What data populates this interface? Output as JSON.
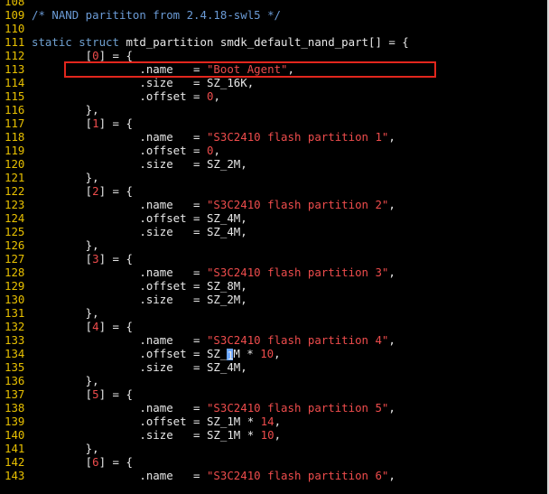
{
  "editor": {
    "lines": [
      {
        "ln": "108",
        "code": [
          {
            "t": "",
            "c": "plain"
          }
        ]
      },
      {
        "ln": "109",
        "code": [
          {
            "t": "/* NAND parititon from 2.4.18-swl5 */",
            "c": "cm"
          }
        ]
      },
      {
        "ln": "110",
        "code": [
          {
            "t": "",
            "c": "plain"
          }
        ]
      },
      {
        "ln": "111",
        "code": [
          {
            "t": "static struct",
            "c": "kw"
          },
          {
            "t": " mtd_partition smdk_default_nand_part[] = {",
            "c": "plain"
          }
        ]
      },
      {
        "ln": "112",
        "code": [
          {
            "t": "        [",
            "c": "plain"
          },
          {
            "t": "0",
            "c": "num"
          },
          {
            "t": "] = {",
            "c": "plain"
          }
        ]
      },
      {
        "ln": "113",
        "code": [
          {
            "t": "                .name   = ",
            "c": "plain"
          },
          {
            "t": "\"Boot Agent\"",
            "c": "str"
          },
          {
            "t": ",",
            "c": "plain"
          }
        ]
      },
      {
        "ln": "114",
        "code": [
          {
            "t": "                .size   = SZ_16K,",
            "c": "plain"
          }
        ]
      },
      {
        "ln": "115",
        "code": [
          {
            "t": "                .offset = ",
            "c": "plain"
          },
          {
            "t": "0",
            "c": "num"
          },
          {
            "t": ",",
            "c": "plain"
          }
        ]
      },
      {
        "ln": "116",
        "code": [
          {
            "t": "        },",
            "c": "plain"
          }
        ]
      },
      {
        "ln": "117",
        "code": [
          {
            "t": "        [",
            "c": "plain"
          },
          {
            "t": "1",
            "c": "num"
          },
          {
            "t": "] = {",
            "c": "plain"
          }
        ]
      },
      {
        "ln": "118",
        "code": [
          {
            "t": "                .name   = ",
            "c": "plain"
          },
          {
            "t": "\"S3C2410 flash partition 1\"",
            "c": "str"
          },
          {
            "t": ",",
            "c": "plain"
          }
        ]
      },
      {
        "ln": "119",
        "code": [
          {
            "t": "                .offset = ",
            "c": "plain"
          },
          {
            "t": "0",
            "c": "num"
          },
          {
            "t": ",",
            "c": "plain"
          }
        ]
      },
      {
        "ln": "120",
        "code": [
          {
            "t": "                .size   = SZ_2M,",
            "c": "plain"
          }
        ]
      },
      {
        "ln": "121",
        "code": [
          {
            "t": "        },",
            "c": "plain"
          }
        ]
      },
      {
        "ln": "122",
        "code": [
          {
            "t": "        [",
            "c": "plain"
          },
          {
            "t": "2",
            "c": "num"
          },
          {
            "t": "] = {",
            "c": "plain"
          }
        ]
      },
      {
        "ln": "123",
        "code": [
          {
            "t": "                .name   = ",
            "c": "plain"
          },
          {
            "t": "\"S3C2410 flash partition 2\"",
            "c": "str"
          },
          {
            "t": ",",
            "c": "plain"
          }
        ]
      },
      {
        "ln": "124",
        "code": [
          {
            "t": "                .offset = SZ_4M,",
            "c": "plain"
          }
        ]
      },
      {
        "ln": "125",
        "code": [
          {
            "t": "                .size   = SZ_4M,",
            "c": "plain"
          }
        ]
      },
      {
        "ln": "126",
        "code": [
          {
            "t": "        },",
            "c": "plain"
          }
        ]
      },
      {
        "ln": "127",
        "code": [
          {
            "t": "        [",
            "c": "plain"
          },
          {
            "t": "3",
            "c": "num"
          },
          {
            "t": "] = {",
            "c": "plain"
          }
        ]
      },
      {
        "ln": "128",
        "code": [
          {
            "t": "                .name   = ",
            "c": "plain"
          },
          {
            "t": "\"S3C2410 flash partition 3\"",
            "c": "str"
          },
          {
            "t": ",",
            "c": "plain"
          }
        ]
      },
      {
        "ln": "129",
        "code": [
          {
            "t": "                .offset = SZ_8M,",
            "c": "plain"
          }
        ]
      },
      {
        "ln": "130",
        "code": [
          {
            "t": "                .size   = SZ_2M,",
            "c": "plain"
          }
        ]
      },
      {
        "ln": "131",
        "code": [
          {
            "t": "        },",
            "c": "plain"
          }
        ]
      },
      {
        "ln": "132",
        "code": [
          {
            "t": "        [",
            "c": "plain"
          },
          {
            "t": "4",
            "c": "num"
          },
          {
            "t": "] = {",
            "c": "plain"
          }
        ]
      },
      {
        "ln": "133",
        "code": [
          {
            "t": "                .name   = ",
            "c": "plain"
          },
          {
            "t": "\"S3C2410 flash partition 4\"",
            "c": "str"
          },
          {
            "t": ",",
            "c": "plain"
          }
        ]
      },
      {
        "ln": "134",
        "code": [
          {
            "t": "                .offset = SZ_",
            "c": "plain"
          },
          {
            "t": "1",
            "c": "cursor"
          },
          {
            "t": "M * ",
            "c": "plain"
          },
          {
            "t": "10",
            "c": "num"
          },
          {
            "t": ",",
            "c": "plain"
          }
        ]
      },
      {
        "ln": "135",
        "code": [
          {
            "t": "                .size   = SZ_4M,",
            "c": "plain"
          }
        ]
      },
      {
        "ln": "136",
        "code": [
          {
            "t": "        },",
            "c": "plain"
          }
        ]
      },
      {
        "ln": "137",
        "code": [
          {
            "t": "        [",
            "c": "plain"
          },
          {
            "t": "5",
            "c": "num"
          },
          {
            "t": "] = {",
            "c": "plain"
          }
        ]
      },
      {
        "ln": "138",
        "code": [
          {
            "t": "                .name   = ",
            "c": "plain"
          },
          {
            "t": "\"S3C2410 flash partition 5\"",
            "c": "str"
          },
          {
            "t": ",",
            "c": "plain"
          }
        ]
      },
      {
        "ln": "139",
        "code": [
          {
            "t": "                .offset = SZ_1M * ",
            "c": "plain"
          },
          {
            "t": "14",
            "c": "num"
          },
          {
            "t": ",",
            "c": "plain"
          }
        ]
      },
      {
        "ln": "140",
        "code": [
          {
            "t": "                .size   = SZ_1M * ",
            "c": "plain"
          },
          {
            "t": "10",
            "c": "num"
          },
          {
            "t": ",",
            "c": "plain"
          }
        ]
      },
      {
        "ln": "141",
        "code": [
          {
            "t": "        },",
            "c": "plain"
          }
        ]
      },
      {
        "ln": "142",
        "code": [
          {
            "t": "        [",
            "c": "plain"
          },
          {
            "t": "6",
            "c": "num"
          },
          {
            "t": "] = {",
            "c": "plain"
          }
        ]
      },
      {
        "ln": "143",
        "code": [
          {
            "t": "                .name   = ",
            "c": "plain"
          },
          {
            "t": "\"S3C2410 flash partition 6\"",
            "c": "str"
          },
          {
            "t": ",",
            "c": "plain"
          }
        ]
      }
    ]
  },
  "colors": {
    "background": "#000000",
    "line_number": "#e8c000",
    "keyword": "#6fa0d0",
    "string": "#ee4c4c",
    "comment": "#6b9bd6",
    "highlight_box": "#e2261d",
    "cursor": "#6aa6ff"
  }
}
